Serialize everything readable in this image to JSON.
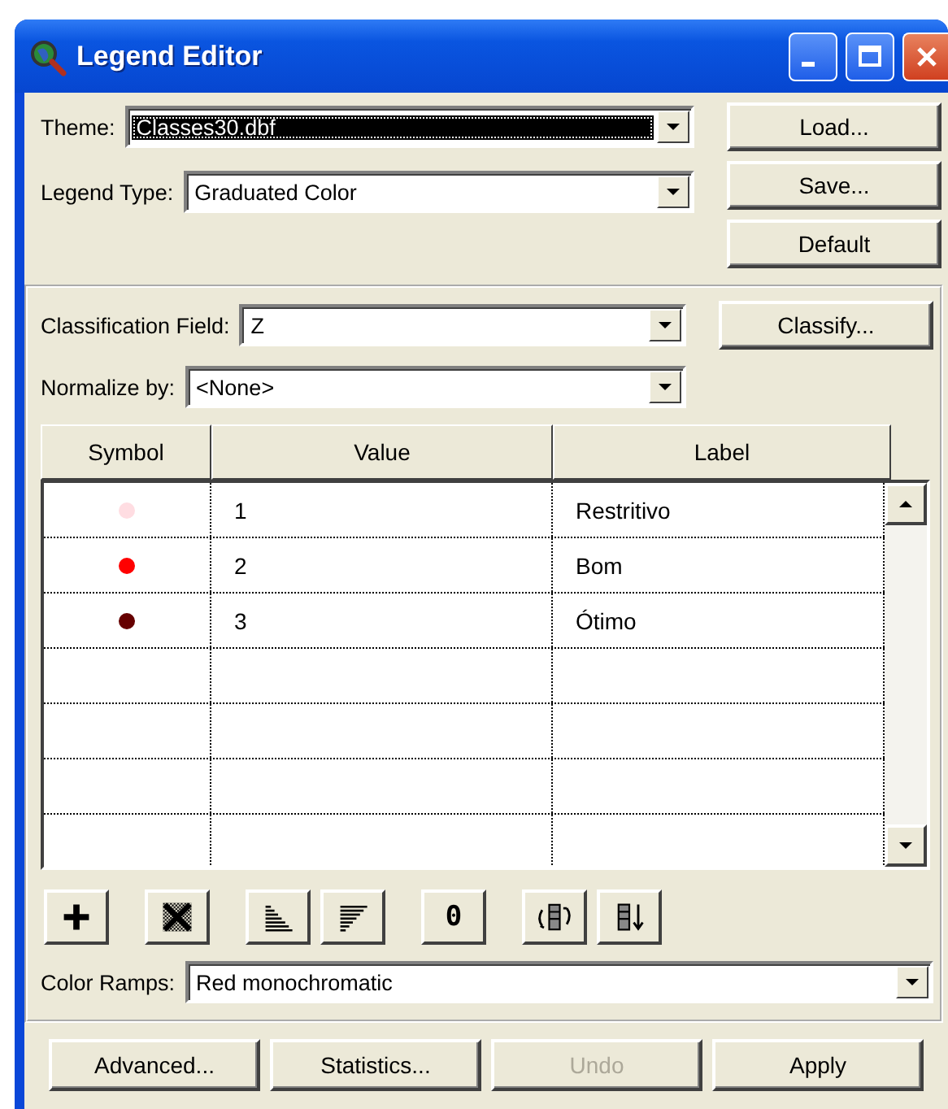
{
  "window": {
    "title": "Legend Editor"
  },
  "theme": {
    "label": "Theme:",
    "value": "Classes30.dbf",
    "highlighted": true
  },
  "legend_type": {
    "label": "Legend Type:",
    "value": "Graduated Color"
  },
  "side_buttons": [
    {
      "label": "Load...",
      "disabled": false
    },
    {
      "label": "Save...",
      "disabled": false
    },
    {
      "label": "Default",
      "disabled": false
    }
  ],
  "classification_field": {
    "label": "Classification Field:",
    "value": "Z"
  },
  "classify_button": {
    "label": "Classify...",
    "disabled": false
  },
  "normalize_by": {
    "label": "Normalize by:",
    "value": "<None>"
  },
  "table": {
    "columns": [
      "Symbol",
      "Value",
      "Label"
    ],
    "rows": [
      {
        "color": "#ffdde2",
        "value": "1",
        "label": "Restritivo"
      },
      {
        "color": "#ff0000",
        "value": "2",
        "label": "Bom"
      },
      {
        "color": "#660000",
        "value": "3",
        "label": "Ótimo"
      }
    ]
  },
  "toolbar": [
    {
      "kind": "add"
    },
    {
      "kind": "delete"
    },
    {
      "kind": "ascending"
    },
    {
      "kind": "descending"
    },
    {
      "kind": "text",
      "label": "0"
    },
    {
      "kind": "flip"
    },
    {
      "kind": "sort"
    }
  ],
  "color_ramps": {
    "label": "Color Ramps:",
    "value": "Red monochromatic"
  },
  "bottom_buttons": [
    {
      "label": "Advanced...",
      "disabled": false
    },
    {
      "label": "Statistics...",
      "disabled": false
    },
    {
      "label": "Undo",
      "disabled": true
    },
    {
      "label": "Apply",
      "disabled": false
    }
  ]
}
